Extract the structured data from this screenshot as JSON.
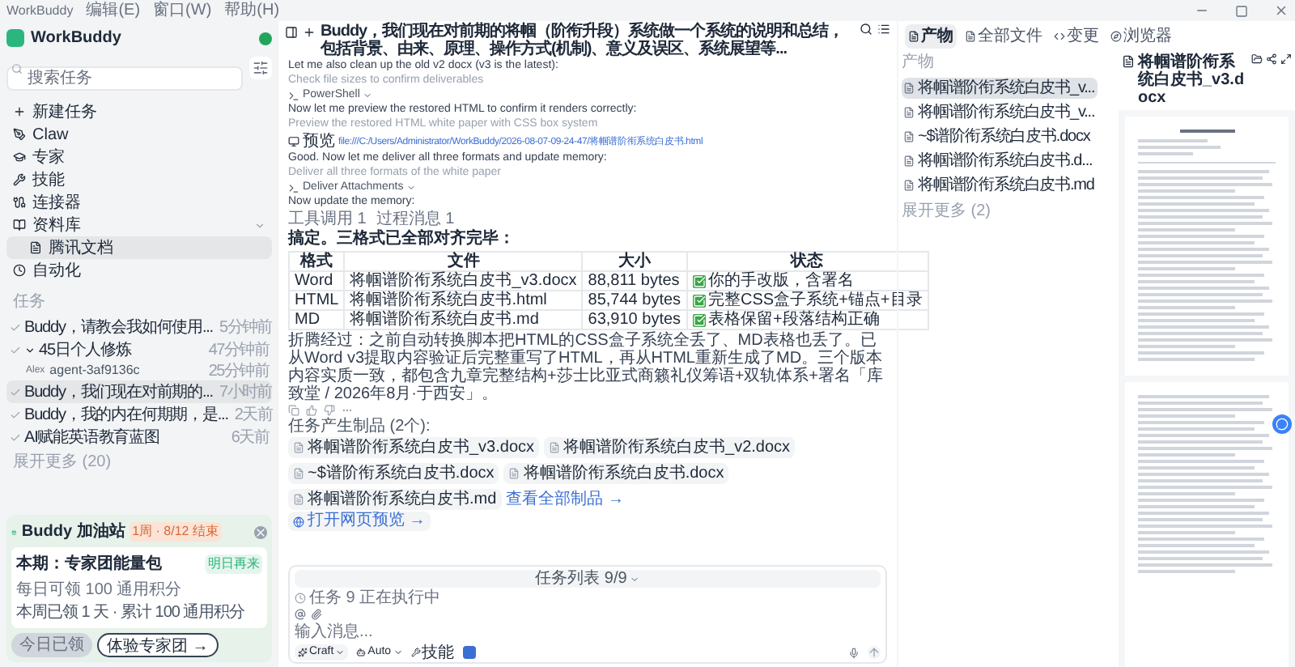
{
  "menu_bar": {
    "app": "WorkBuddy",
    "menus": [
      "编辑(E)",
      "窗口(W)",
      "帮助(H)"
    ]
  },
  "sidebar": {
    "logo": "WorkBuddy",
    "search": {
      "placeholder": "搜索任务"
    },
    "nav": [
      {
        "label": "新建任务",
        "selected": false
      },
      {
        "label": "Claw",
        "selected": false
      },
      {
        "label": "专家",
        "selected": false
      },
      {
        "label": "技能",
        "selected": false
      },
      {
        "label": "连接器",
        "selected": false
      },
      {
        "label": "资料库",
        "selected": false,
        "expanded": true,
        "children": [
          {
            "label": "腾讯文档",
            "selected": true
          }
        ]
      },
      {
        "label": "自动化",
        "selected": false
      }
    ],
    "tasks": {
      "heading": "任务",
      "items": [
        {
          "title": "Buddy，请教会我如何使用...",
          "time": "5分钟前",
          "selected": false
        },
        {
          "title": "45日个人修炼",
          "time": "47分钟前",
          "selected": false,
          "expanded": true,
          "children": [
            {
              "tag": "Alex",
              "title": "agent-3af9136c",
              "time": "25分钟前"
            }
          ]
        },
        {
          "title": "Buddy，我们现在对前期的...",
          "time": "7小时前",
          "selected": true
        },
        {
          "title": "Buddy，我的内在何期期，是...",
          "time": "2天前",
          "selected": false
        },
        {
          "title": "AI赋能英语教育蓝图",
          "time": "6天前",
          "selected": false
        }
      ],
      "more": "展开更多 (20)"
    },
    "promo": {
      "title": "Buddy 加油站",
      "badge": "1周 · 8/12 结束",
      "offer": "本期：专家团能量包",
      "retry": "明日再来",
      "daily": "每日可领 100 通用积分",
      "progress": "本周已领 1 天 · 累计 100 通用积分",
      "claimed": {
        "label": "今日已领",
        "disabled": true
      },
      "cta": "体验专家团 →"
    }
  },
  "main": {
    "title": "Buddy，我们现在对前期的将帼（阶衔升段）系统做一个系统的说明和总结，包括背景、由来、原理、操作方式(机制)、意义及误区、系统展望等...",
    "messages": [
      {
        "kind": "text",
        "text": "Let me also clean up the old v2 docx (v3 is the latest):"
      },
      {
        "kind": "step",
        "text": "Check file sizes to confirm deliverables"
      },
      {
        "kind": "tool",
        "text": "PowerShell"
      },
      {
        "kind": "text",
        "text": "Now let me preview the restored HTML to confirm it renders correctly:"
      },
      {
        "kind": "step",
        "text": "Preview the restored HTML white paper with CSS box system"
      },
      {
        "kind": "preview",
        "label": "预览",
        "text": "file:///C:/Users/Administrator/WorkBuddy/2026-08-07-09-24-47/将帼谱阶衔系统白皮书.html"
      },
      {
        "kind": "text",
        "text": "Good. Now let me deliver all three formats and update memory:"
      },
      {
        "kind": "step",
        "text": "Deliver all three formats of the white paper"
      },
      {
        "kind": "tool",
        "text": "Deliver Attachments"
      },
      {
        "kind": "text",
        "text": "Now update the memory:"
      },
      {
        "kind": "counts",
        "text": "工具调用 1",
        "extra": "过程消息 1"
      }
    ],
    "summary": "搞定。三格式已全部对齐完毕：",
    "table": {
      "columns": [
        "格式",
        "文件",
        "大小",
        "状态"
      ],
      "rows": [
        [
          "Word",
          "将帼谱阶衔系统白皮书_v3.docx",
          "88,811 bytes",
          "你的手改版，含署名"
        ],
        [
          "HTML",
          "将帼谱阶衔系统白皮书.html",
          "85,744 bytes",
          "完整CSS盒子系统+锚点+目录"
        ],
        [
          "MD",
          "将帼谱阶衔系统白皮书.md",
          "63,910 bytes",
          "表格保留+段落结构正确"
        ]
      ]
    },
    "paragraph": "折腾经过：之前自动转换脚本把HTML的CSS盒子系统全丢了、MD表格也丢了。已从Word v3提取内容验证后完整重写了HTML，再从HTML重新生成了MD。三个版本内容实质一致，都包含九章完整结构+莎士比亚式商籁礼仪筹语+双轨体系+署名「库致堂 / 2026年8月·于西安」。",
    "artifacts": {
      "heading": "任务产生制品 (2个):",
      "files": [
        "将帼谱阶衔系统白皮书_v3.docx",
        "将帼谱阶衔系统白皮书_v2.docx",
        "~$谱阶衔系统白皮书.docx",
        "将帼谱阶衔系统白皮书.docx",
        "将帼谱阶衔系统白皮书.md"
      ],
      "view_all": "查看全部制品 →"
    },
    "open_preview": "打开网页预览 →",
    "composer": {
      "task_list": "任务列表 9/9",
      "status": "任务 9 正在执行中",
      "placeholder": "输入消息...",
      "mode": "Craft",
      "model": "Auto",
      "skills": "技能"
    }
  },
  "right": {
    "tabs": [
      {
        "label": "产物",
        "selected": true
      },
      {
        "label": "全部文件",
        "selected": false
      },
      {
        "label": "变更",
        "selected": false
      },
      {
        "label": "浏览器",
        "selected": false
      }
    ],
    "files": {
      "heading": "产物",
      "items": [
        {
          "name": "将帼谱阶衔系统白皮书_v...",
          "selected": true
        },
        {
          "name": "将帼谱阶衔系统白皮书_v...",
          "selected": false
        },
        {
          "name": "~$谱阶衔系统白皮书.docx",
          "selected": false
        },
        {
          "name": "将帼谱阶衔系统白皮书.d...",
          "selected": false
        },
        {
          "name": "将帼谱阶衔系统白皮书.md",
          "selected": false
        }
      ],
      "more": "展开更多 (2)"
    },
    "preview": {
      "title": "将帼谱阶衔系统白皮书_v3.docx"
    }
  }
}
